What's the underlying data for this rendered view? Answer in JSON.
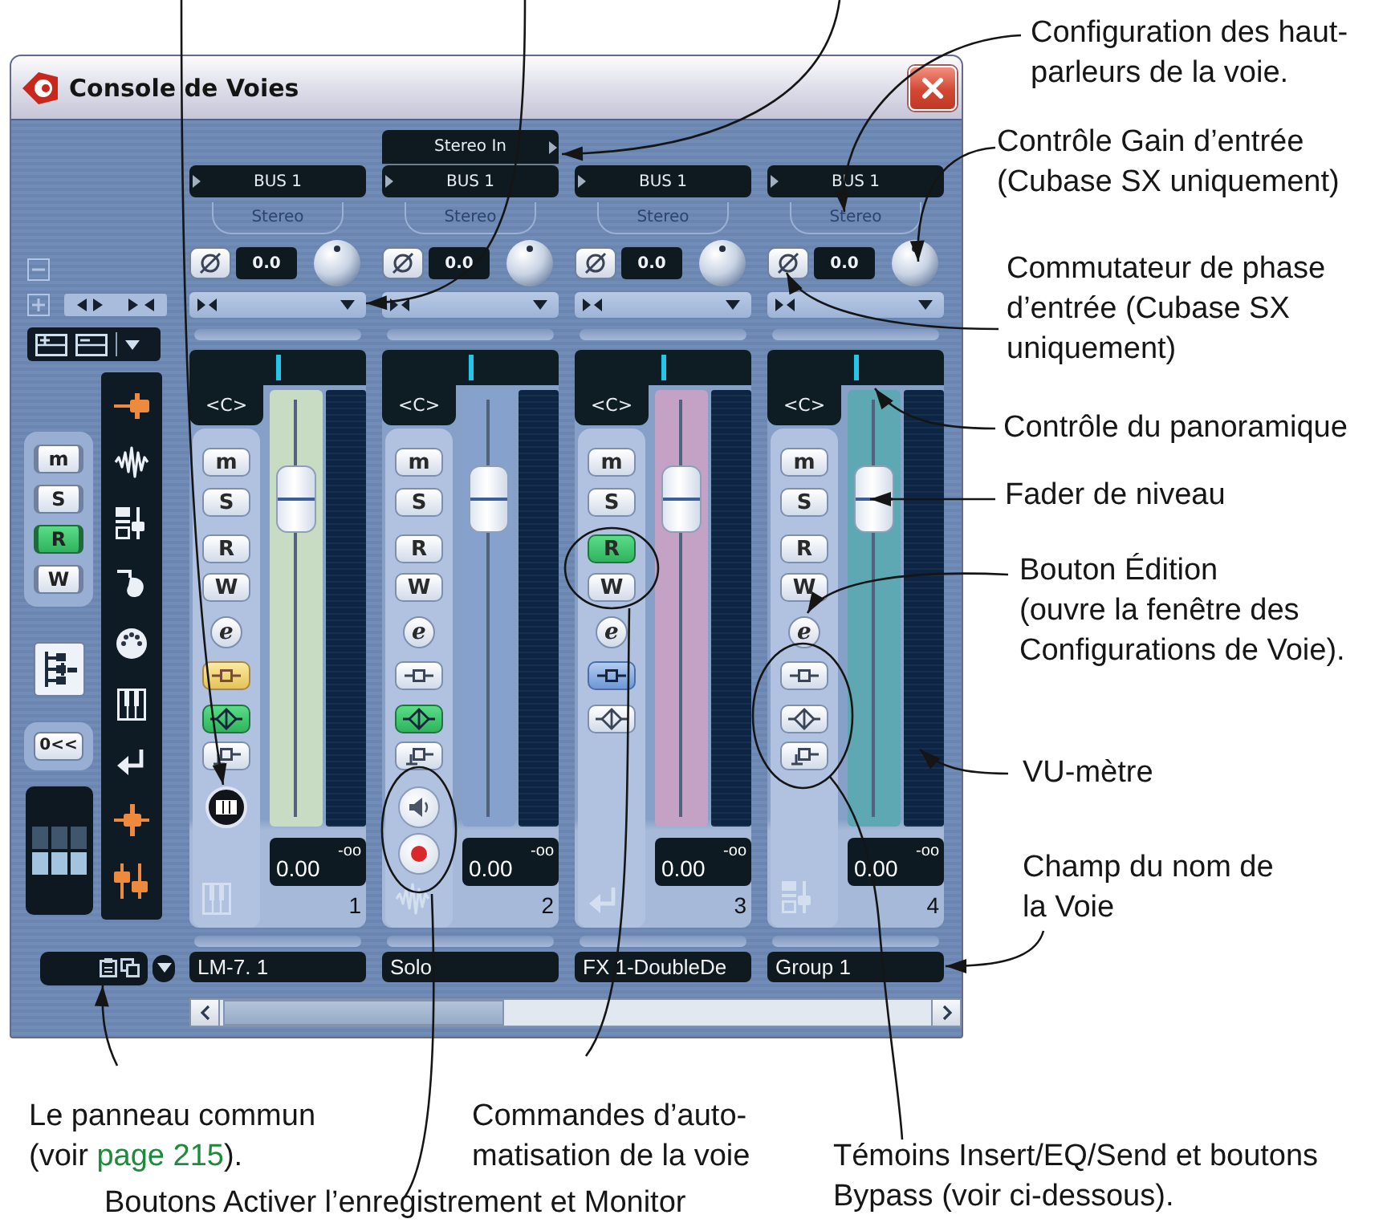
{
  "window": {
    "title": "Console de Voies"
  },
  "common_panel": {
    "global_buttons": [
      {
        "label": "m",
        "on": false
      },
      {
        "label": "S",
        "on": false
      },
      {
        "label": "R",
        "on": true
      },
      {
        "label": "W",
        "on": false
      }
    ],
    "reset_button": {
      "label": "0<<"
    },
    "filters": [
      {
        "kind": "input",
        "on": true
      },
      {
        "kind": "audio",
        "on": false
      },
      {
        "kind": "group",
        "on": false
      },
      {
        "kind": "fx",
        "on": false
      },
      {
        "kind": "midi",
        "on": false
      },
      {
        "kind": "instrument",
        "on": false
      },
      {
        "kind": "return",
        "on": false
      },
      {
        "kind": "output",
        "on": true
      },
      {
        "kind": "master",
        "on": true
      }
    ]
  },
  "channels": [
    {
      "kind": "midi",
      "color": "#c8dcc4",
      "output": "BUS 1",
      "config": "Stereo",
      "gain": "0.0",
      "pan": {
        "reading": "<C>",
        "level": 0.5
      },
      "buttons": [
        {
          "kind": "mute",
          "label": "m",
          "on": false
        },
        {
          "kind": "solo",
          "label": "S",
          "on": false
        },
        {
          "kind": "read",
          "label": "R",
          "on": false
        },
        {
          "kind": "write",
          "label": "W",
          "on": false
        },
        {
          "kind": "edit",
          "label": "e",
          "on": false
        }
      ],
      "fx": [
        {
          "kind": "insert",
          "on": false,
          "bypassed": true
        },
        {
          "kind": "eq",
          "on": true,
          "bypassed": false
        },
        {
          "kind": "send",
          "on": false,
          "bypassed": false
        }
      ],
      "fader": {
        "level": 0.75
      },
      "volume": "0.00",
      "peak": "-oo",
      "number": "1",
      "name": "LM-7. 1"
    },
    {
      "kind": "audio",
      "color": "#86a2cc",
      "input": "Stereo In",
      "output": "BUS 1",
      "config": "Stereo",
      "gain": "0.0",
      "pan": {
        "reading": "<C>",
        "level": 0.5
      },
      "buttons": [
        {
          "kind": "mute",
          "label": "m",
          "on": false
        },
        {
          "kind": "solo",
          "label": "S",
          "on": false
        },
        {
          "kind": "read",
          "label": "R",
          "on": false
        },
        {
          "kind": "write",
          "label": "W",
          "on": false
        },
        {
          "kind": "edit",
          "label": "e",
          "on": false
        }
      ],
      "fx": [
        {
          "kind": "insert",
          "on": false,
          "bypassed": false
        },
        {
          "kind": "eq",
          "on": true,
          "bypassed": false
        },
        {
          "kind": "send",
          "on": false,
          "bypassed": false
        }
      ],
      "monitor": false,
      "record": false,
      "fader": {
        "level": 0.75
      },
      "volume": "0.00",
      "peak": "-oo",
      "number": "2",
      "name": "Solo"
    },
    {
      "kind": "fx",
      "color": "#c4a2c6",
      "output": "BUS 1",
      "config": "Stereo",
      "gain": "0.0",
      "pan": {
        "reading": "<C>",
        "level": 0.5
      },
      "buttons": [
        {
          "kind": "mute",
          "label": "m",
          "on": false
        },
        {
          "kind": "solo",
          "label": "S",
          "on": false
        },
        {
          "kind": "read",
          "label": "R",
          "on": true
        },
        {
          "kind": "write",
          "label": "W",
          "on": false
        },
        {
          "kind": "edit",
          "label": "e",
          "on": false
        }
      ],
      "fx": [
        {
          "kind": "insert",
          "on": true,
          "bypassed": false
        },
        {
          "kind": "eq",
          "on": false,
          "bypassed": false
        }
      ],
      "fader": {
        "level": 0.75
      },
      "volume": "0.00",
      "peak": "-oo",
      "number": "3",
      "name": "FX 1-DoubleDe"
    },
    {
      "kind": "group",
      "color": "#5ea8b4",
      "output": "BUS 1",
      "config": "Stereo",
      "gain": "0.0",
      "pan": {
        "reading": "<C>",
        "level": 0.5
      },
      "buttons": [
        {
          "kind": "mute",
          "label": "m",
          "on": false
        },
        {
          "kind": "solo",
          "label": "S",
          "on": false
        },
        {
          "kind": "read",
          "label": "R",
          "on": false
        },
        {
          "kind": "write",
          "label": "W",
          "on": false
        },
        {
          "kind": "edit",
          "label": "e",
          "on": false
        }
      ],
      "fx": [
        {
          "kind": "insert",
          "on": false,
          "bypassed": false
        },
        {
          "kind": "eq",
          "on": false,
          "bypassed": false
        },
        {
          "kind": "send",
          "on": false,
          "bypassed": false
        }
      ],
      "fader": {
        "level": 0.75
      },
      "volume": "0.00",
      "peak": "-oo",
      "number": "4",
      "name": "Group 1"
    }
  ],
  "callouts": [
    {
      "text": "Configuration des haut-\nparleurs de la voie."
    },
    {
      "text": "Contrôle Gain d’entrée\n(Cubase SX uniquement)"
    },
    {
      "text": "Commutateur de phase\nd’entrée (Cubase SX\nuniquement)"
    },
    {
      "text": "Contrôle du panoramique"
    },
    {
      "text": "Fader de niveau"
    },
    {
      "text": "Bouton Édition\n(ouvre la fenêtre des\nConfigurations de Voie)."
    },
    {
      "text": "VU-mètre"
    },
    {
      "text": "Champ du nom de\nla Voie"
    },
    {
      "text": "Le panneau commun\n(voir ",
      "link": "page 215",
      "after": ")."
    },
    {
      "text": "Commandes d’auto-\nmatisation de la voie"
    },
    {
      "text": "Boutons Activer l’enregistrement et Monitor"
    },
    {
      "text": "Témoins Insert/EQ/Send et boutons\nBypass (voir ci-dessous)."
    }
  ]
}
